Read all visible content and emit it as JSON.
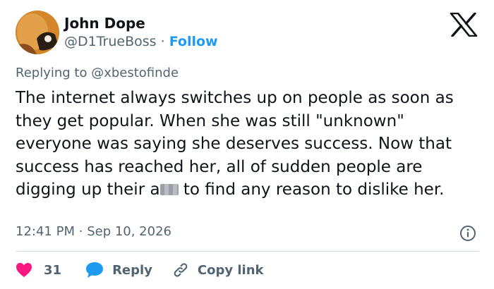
{
  "author": {
    "name": "John Dope",
    "handle": "@D1TrueBoss",
    "separator": "·",
    "follow_label": "Follow"
  },
  "replying": {
    "prefix": "Replying to ",
    "mention": "@xbestofinde"
  },
  "tweet": {
    "text_before_censor": "The internet always switches up on people as soon as they get popular. When she was still \"unknown\" everyone was saying she deserves success. Now that success has reached her, all of sudden people are digging up their a",
    "text_after_censor": " to find any reason to dislike her."
  },
  "meta": {
    "time": "12:41 PM",
    "separator": "·",
    "date": "Sep 10, 2026"
  },
  "actions": {
    "like_count": "31",
    "reply_label": "Reply",
    "copy_link_label": "Copy link"
  },
  "icons": {
    "logo": "x-logo-icon",
    "info": "info-icon",
    "like": "heart-icon",
    "reply": "speech-bubble-icon",
    "copy": "link-icon"
  },
  "colors": {
    "accent": "#1d9bf0",
    "heart": "#f91880",
    "secondary_text": "#536471",
    "primary_text": "#0f1419"
  }
}
